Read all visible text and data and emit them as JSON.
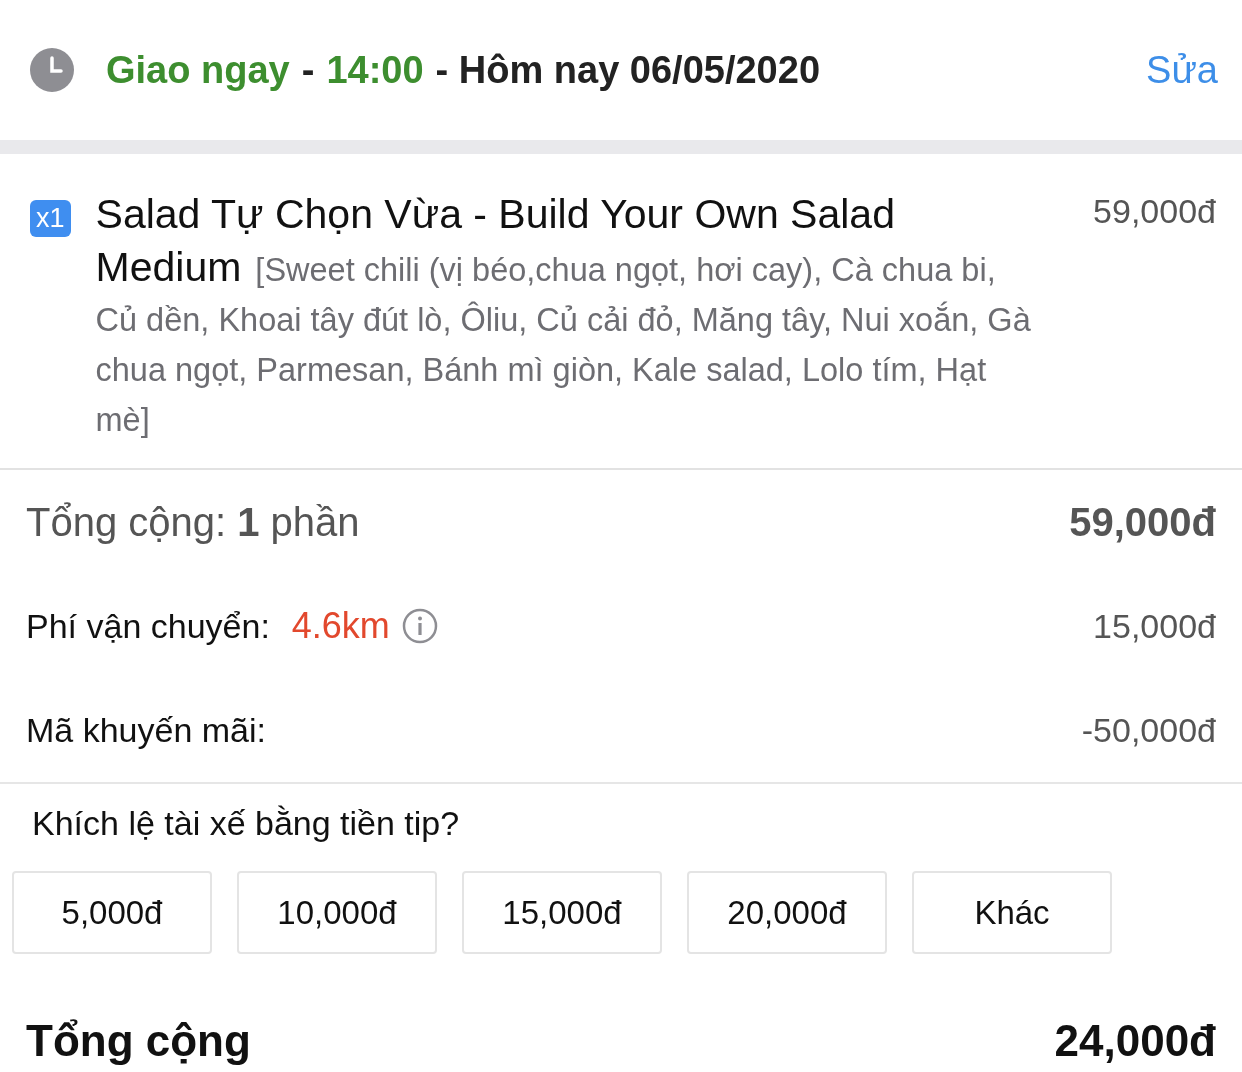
{
  "delivery": {
    "parts": [
      {
        "text": "Giao ngay",
        "kind": "highlight"
      },
      {
        "text": "-",
        "kind": "plain"
      },
      {
        "text": "14:00",
        "kind": "highlight"
      },
      {
        "text": "- Hôm nay 06/05/2020",
        "kind": "plain"
      }
    ],
    "edit_link": "Sửa"
  },
  "items": [
    {
      "quantity": "x1",
      "name": "Salad Tự Chọn Vừa - Build Your Own Salad Medium",
      "options": "[Sweet chili (vị béo,chua ngọt, hơi cay), Cà chua bi, Củ dền, Khoai tây đút lò, Ôliu, Củ cải đỏ, Măng tây, Nui xoắn, Gà chua ngọt, Parmesan, Bánh mì giòn, Kale salad, Lolo tím, Hạt mè]",
      "price": "59,000đ"
    }
  ],
  "summary": [
    {
      "kind": "subtotal",
      "label": "Tổng cộng: **1** phần",
      "value": "59,000đ"
    },
    {
      "kind": "shipping",
      "label": "Phí vận chuyển:",
      "distance": "4.6km",
      "value": "15,000đ"
    },
    {
      "kind": "promo",
      "label": "Mã khuyến mãi:",
      "value": "-50,000đ"
    }
  ],
  "tip": {
    "question": "Khích lệ tài xế bằng tiền tip?",
    "options": [
      {
        "label": "5,000đ",
        "selected": false
      },
      {
        "label": "10,000đ",
        "selected": false
      },
      {
        "label": "15,000đ",
        "selected": false
      },
      {
        "label": "20,000đ",
        "selected": false
      },
      {
        "label": "Khác",
        "selected": false
      }
    ]
  },
  "total": {
    "label": "Tổng cộng",
    "value": "24,000đ"
  }
}
